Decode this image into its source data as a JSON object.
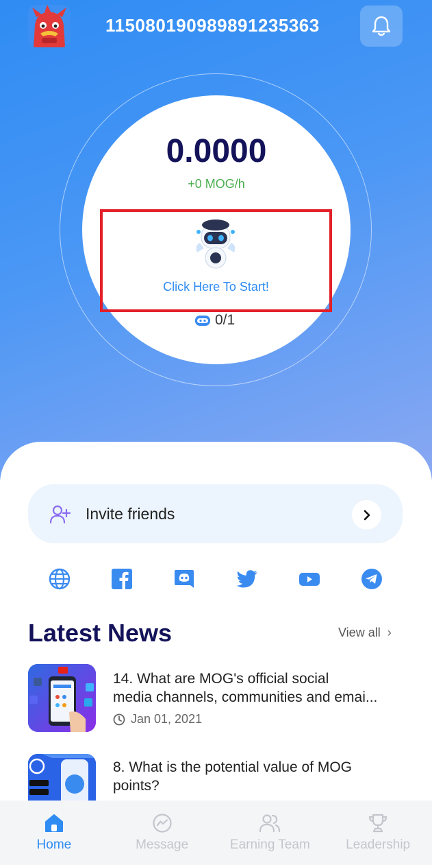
{
  "header": {
    "user_id": "115080190989891235363",
    "avatar_icon": "red-monster-avatar",
    "bell_icon": "bell-icon"
  },
  "mining": {
    "balance": "0.0000",
    "rate": "+0 MOG/h",
    "start_label": "Click Here To Start!",
    "robot_icon": "robot-icon",
    "slots": "0/1"
  },
  "invite": {
    "label": "Invite friends"
  },
  "socials": [
    "globe-icon",
    "facebook-icon",
    "discord-icon",
    "twitter-icon",
    "youtube-icon",
    "telegram-icon"
  ],
  "news": {
    "title": "Latest News",
    "view_all": "View all",
    "items": [
      {
        "line1": "14. What are MOG's official social",
        "line2": "media channels, communities and emai...",
        "date": "Jan 01, 2021"
      },
      {
        "line1": "8. What is the potential value of MOG",
        "line2": "points?"
      }
    ]
  },
  "tabs": [
    {
      "label": "Home",
      "icon": "home-icon",
      "active": true
    },
    {
      "label": "Message",
      "icon": "message-icon",
      "active": false
    },
    {
      "label": "Earning Team",
      "icon": "team-icon",
      "active": false
    },
    {
      "label": "Leadership",
      "icon": "trophy-icon",
      "active": false
    }
  ],
  "colors": {
    "hero_start": "#2f8cf3",
    "hero_end": "#8aa8f2",
    "title_navy": "#14135a",
    "rate_green": "#4caf50",
    "highlight_red": "#e3202a",
    "active_tab": "#2f8cf3"
  }
}
